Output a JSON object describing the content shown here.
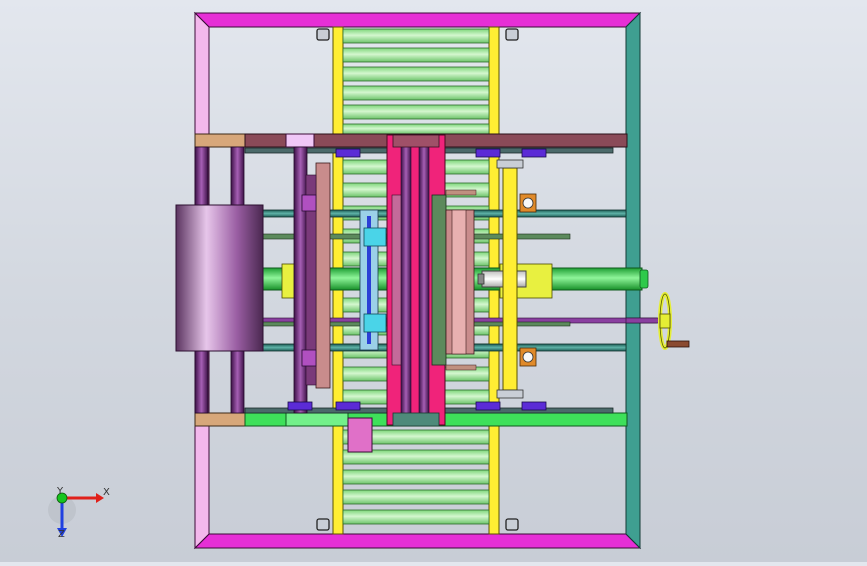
{
  "viewport": {
    "name": "cad-model-viewport",
    "background": "gradient-gray"
  },
  "colors": {
    "frame_magenta": "#e62fd6",
    "frame_pink": "#f3b8ec",
    "frame_teal": "#3f9f91",
    "roller_green": "#a6e8a3",
    "rail_yellow": "#ffee33",
    "drum_purple": "#b27bb7",
    "shaft_purple": "#6e2b80",
    "shaft_green": "#32d14e",
    "handwheel_yellow": "#e5ee35"
  },
  "triad": {
    "x_label": "X",
    "y_label": "Y",
    "z_label": "Z"
  }
}
